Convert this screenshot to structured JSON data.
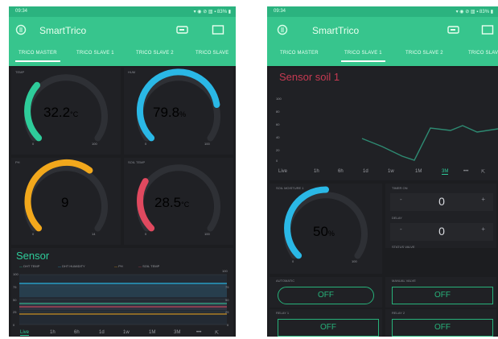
{
  "status_bar": {
    "time": "09:34",
    "right": "▾ ◉ ⊘ ▥ ▪ 83% ▮"
  },
  "app": {
    "title": "SmartTrico"
  },
  "tabs": [
    "TRICO MASTER",
    "TRICO SLAVE 1",
    "TRICO SLAVE 2",
    "TRICO SLAVE"
  ],
  "left_screen": {
    "active_tab": "TRICO MASTER",
    "gauges": [
      {
        "label": "TEMP",
        "value": "32.2",
        "unit": "°C",
        "min": "0",
        "max": "100",
        "level": 0.32,
        "color": "#2ecc9a"
      },
      {
        "label": "HUM",
        "value": "79.8",
        "unit": "%",
        "min": "0",
        "max": "100",
        "level": 0.8,
        "color": "#2ab8e6"
      },
      {
        "label": "PH",
        "value": "9",
        "unit": "",
        "min": "0",
        "max": "14",
        "level": 0.64,
        "color": "#f2a81c"
      },
      {
        "label": "SOIL TEMP",
        "value": "28.5",
        "unit": "°C",
        "min": "0",
        "max": "100",
        "level": 0.28,
        "color": "#e0495f"
      }
    ],
    "sensor_title": "Sensor",
    "legend": [
      "DHT TEMP",
      "DHT HUMIDITY",
      "PH",
      "SOIL TEMP"
    ],
    "legend_colors": [
      "#2ecc9a",
      "#2ab8e6",
      "#f2a81c",
      "#e0495f"
    ],
    "axis_left": [
      "100",
      "75",
      "50",
      "25",
      "0"
    ],
    "axis_right": [
      "100",
      "75",
      "50",
      "25",
      "0"
    ],
    "periods": [
      "Live",
      "1h",
      "6h",
      "1d",
      "1w",
      "1M",
      "3M",
      "•••",
      "⇱"
    ],
    "active_period": "Live"
  },
  "right_screen": {
    "active_tab": "TRICO SLAVE 1",
    "chart_title": "Sensor soil 1",
    "chart_axis": [
      "100",
      "80",
      "60",
      "40",
      "20",
      "0"
    ],
    "periods": [
      "Live",
      "1h",
      "6h",
      "1d",
      "1w",
      "1M",
      "3M",
      "•••",
      "⇱"
    ],
    "active_period": "3M",
    "gauge": {
      "label": "SOIL MOISTURE 1",
      "value": "50",
      "unit": "%",
      "min": "0",
      "max": "100",
      "level": 0.5,
      "color": "#2ab8e6"
    },
    "steppers": [
      {
        "label": "TIMER ON",
        "value": "0",
        "minus": "-",
        "plus": "+"
      },
      {
        "label": "DELAY",
        "value": "0",
        "minus": "-",
        "plus": "+"
      }
    ],
    "status_label": "STATUS VALVE",
    "controls": [
      {
        "label": "AUTOMATIC",
        "button": "OFF"
      },
      {
        "label": "MANUAL VALVE",
        "button": "OFF"
      },
      {
        "label": "RELAY 1",
        "button": "OFF"
      },
      {
        "label": "RELAY 2",
        "button": "OFF"
      }
    ],
    "colors": {
      "chart_line": "#2e8a72",
      "title": "#c63a52"
    }
  },
  "colors": {
    "accent": "#37c58d",
    "status": "#2bb37f",
    "background": "#1c1d20"
  }
}
